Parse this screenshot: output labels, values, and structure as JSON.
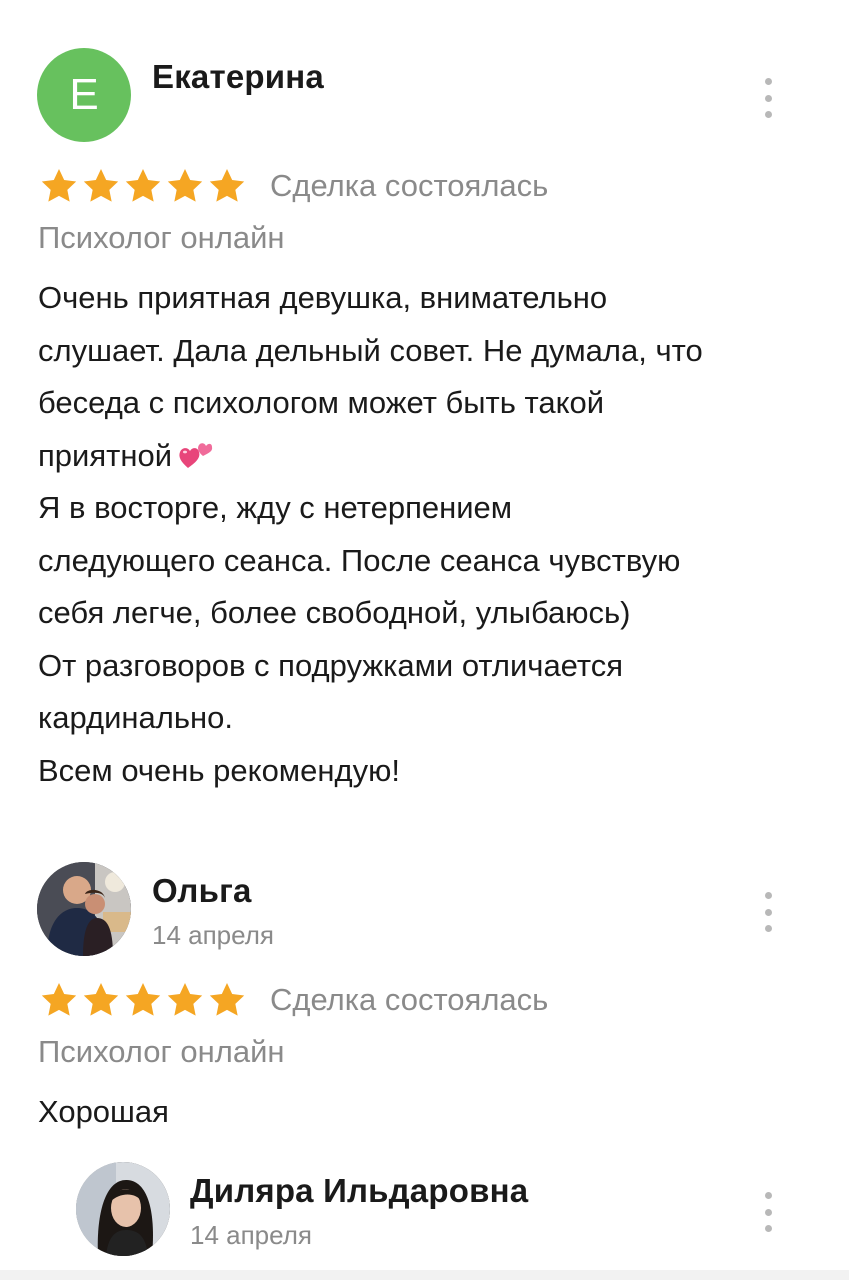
{
  "reviews": [
    {
      "avatar_letter": "Е",
      "avatar_color": "#67c15e",
      "author": "Екатерина",
      "date": "",
      "rating": 5,
      "deal_status": "Сделка состоялась",
      "category": "Психолог онлайн",
      "text_lines": [
        "Очень приятная девушка, внимательно",
        "слушает. Дала дельный совет. Не думала, что",
        "беседа с психологом может быть такой",
        "приятной",
        "Я в восторге, жду с нетерпением",
        "следующего сеанса. После сеанса чувствую",
        "себя легче, более свободной, улыбаюсь)",
        "От разговоров с подружками отличается",
        "кардинально.",
        "Всем очень рекомендую!"
      ],
      "emoji": "two-hearts-icon"
    },
    {
      "avatar": "photo",
      "author": "Ольга",
      "date": "14 апреля",
      "rating": 5,
      "deal_status": "Сделка состоялась",
      "category": "Психолог онлайн",
      "text": "Хорошая"
    }
  ],
  "reply": {
    "avatar": "photo",
    "author": "Диляра Ильдаровна",
    "date": "14 апреля"
  },
  "colors": {
    "star": "#f5a623",
    "muted_text": "#8a8a8a",
    "main_text": "#1a1a1a",
    "kebab": "#b8b8b8"
  }
}
